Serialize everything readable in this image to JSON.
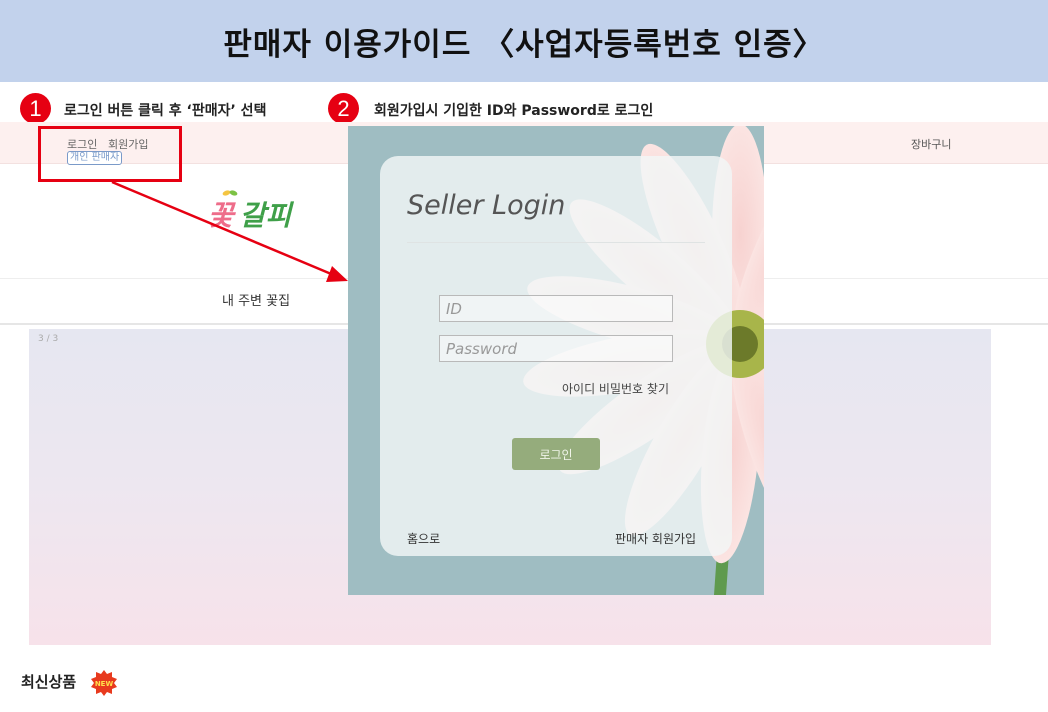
{
  "banner": {
    "title": "판매자 이용가이드 〈사업자등록번호 인증〉"
  },
  "steps": [
    {
      "number": "1",
      "text": "로그인 버튼 클릭 후 ‘판매자’ 선택"
    },
    {
      "number": "2",
      "text": "회원가입시 기입한 ID와 Password로 로그인"
    }
  ],
  "topbar": {
    "login_link": "로그인",
    "signup_link": "회원가입",
    "seller_options": "개인 판매자",
    "cart_link": "장바구니"
  },
  "logo": {
    "text_a": "꽃",
    "text_b": "갈피"
  },
  "nav": {
    "item_nearby": "내 주변 꽃집"
  },
  "hero": {
    "counter": "3 / 3"
  },
  "login": {
    "title": "Seller Login",
    "id_placeholder": "ID",
    "password_placeholder": "Password",
    "find_link": "아이디  비밀번호 찾기",
    "login_button": "로그인",
    "home_link": "홈으로",
    "join_link": "판매자 회원가입"
  },
  "section": {
    "new_products_title": "최신상품",
    "new_badge": "NEW"
  },
  "colors": {
    "banner": "#c2d2ec",
    "step_badge": "#e60012",
    "highlight": "#e60012",
    "topbar": "#fdf0ef",
    "login_panel": "#9fbdc2",
    "login_button": "#95ac7c",
    "logo_pink": "#ee6d8a",
    "logo_green": "#3fa049"
  }
}
